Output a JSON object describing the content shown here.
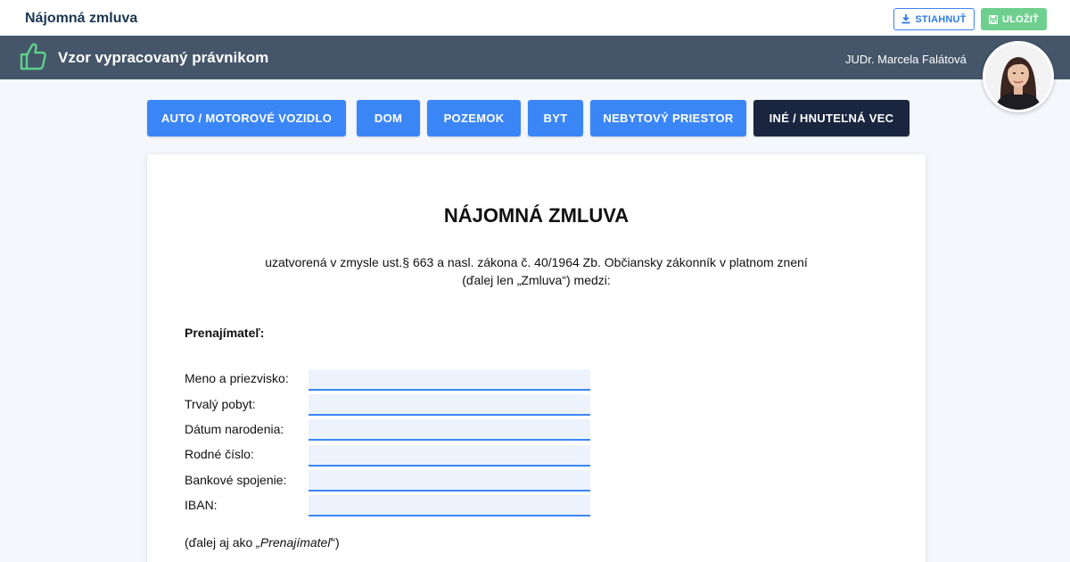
{
  "app": {
    "title": "Nájomná zmluva"
  },
  "toolbar": {
    "download_label": "STIAHNUŤ",
    "save_label": "ULOŽIŤ"
  },
  "banner": {
    "text": "Vzor vypracovaný právnikom",
    "lawyer_name": "JUDr. Marcela Falátová"
  },
  "tabs": [
    {
      "label": "AUTO / MOTOROVÉ VOZIDLO",
      "active": false
    },
    {
      "label": "DOM",
      "active": false
    },
    {
      "label": "POZEMOK",
      "active": false
    },
    {
      "label": "BYT",
      "active": false
    },
    {
      "label": "NEBYTOVÝ PRIESTOR",
      "active": false
    },
    {
      "label": "INÉ / HNUTEĽNÁ VEC",
      "active": true
    }
  ],
  "document": {
    "title": "NÁJOMNÁ ZMLUVA",
    "subtitle_line1": "uzatvorená v zmysle ust.§ 663 a nasl. zákona č. 40/1964 Zb. Občiansky zákonník v platnom znení",
    "subtitle_line2": "(ďalej len „Zmluva“) medzi:",
    "section_label": "Prenajímateľ:",
    "fields": [
      {
        "label": "Meno a priezvisko:",
        "value": ""
      },
      {
        "label": "Trvalý pobyt:",
        "value": ""
      },
      {
        "label": "Dátum narodenia:",
        "value": ""
      },
      {
        "label": "Rodné číslo:",
        "value": ""
      },
      {
        "label": "Bankové spojenie:",
        "value": ""
      },
      {
        "label": "IBAN:",
        "value": ""
      }
    ],
    "footer_prefix": "(ďalej aj ako ",
    "footer_italic": "„Prenajímateľ",
    "footer_suffix": "“)"
  },
  "colors": {
    "accent": "#3b86f7",
    "active_tab": "#1a2540",
    "banner": "#45566a",
    "save": "#6fcf8f"
  },
  "icons": {
    "download": "download-icon",
    "save": "floppy-disk-icon",
    "banner": "thumbs-up-icon"
  }
}
